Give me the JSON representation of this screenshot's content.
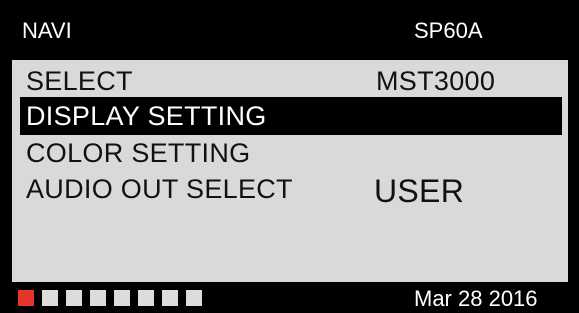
{
  "header": {
    "title": "NAVI",
    "model": "SP60A"
  },
  "menu": {
    "items": [
      {
        "label": "SELECT",
        "value": "MST3000",
        "selected": false
      },
      {
        "label": "DISPLAY SETTING",
        "value": "",
        "selected": true
      },
      {
        "label": "COLOR SETTING",
        "value": "",
        "selected": false
      },
      {
        "label": "AUDIO OUT SELECT",
        "value": "USER",
        "selected": false
      }
    ]
  },
  "footer": {
    "page_indicator": {
      "total": 8,
      "active_index": 0
    },
    "date": "Mar 28 2016"
  },
  "colors": {
    "background": "#000000",
    "panel": "#d9d9d9",
    "selected_bg": "#000000",
    "active_indicator": "#e8352a",
    "inactive_indicator": "#dcdcdc"
  }
}
